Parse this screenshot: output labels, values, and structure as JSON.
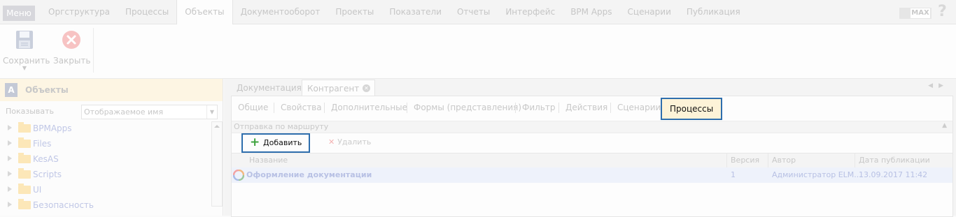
{
  "topbar": {
    "menu_label": "Меню",
    "nav_items": [
      "Оргструктура",
      "Процессы",
      "Объекты",
      "Документооборот",
      "Проекты",
      "Показатели",
      "Отчеты",
      "Интерфейс",
      "BPM Apps",
      "Сценарии",
      "Публикация"
    ],
    "active_nav": "Объекты",
    "max_badge": "MAX",
    "help": "?"
  },
  "toolbar": {
    "save_label": "Сохранить",
    "close_label": "Закрыть",
    "save_icon": "floppy-disk-icon",
    "close_icon": "close-circle-icon"
  },
  "left_panel": {
    "logo_letter": "A",
    "title": "Объекты",
    "show_label": "Показывать",
    "display_select_value": "Отображаемое имя",
    "tree_items": [
      "BPMApps",
      "Files",
      "KesAS",
      "Scripts",
      "UI",
      "Безопасность"
    ]
  },
  "right_panel": {
    "doc_tabs": [
      "Документация",
      "Контрагент"
    ],
    "active_doc_tab": "Контрагент",
    "sub_tabs": [
      "Общие",
      "Свойства",
      "Дополнительные",
      "Формы (представления)",
      "Фильтр",
      "Действия",
      "Сценарии",
      "Процессы"
    ],
    "active_sub_tab": "Процессы",
    "route_title": "Отправка по маршруту",
    "add_label": "Добавить",
    "delete_label": "Удалить",
    "columns": [
      "Название",
      "Версия",
      "Автор",
      "Дата публикации"
    ],
    "rows": [
      {
        "name": "Оформление документации",
        "version": "1",
        "author": "Администратор ELM...",
        "date": "13.09.2017 11:42"
      }
    ]
  },
  "colors": {
    "highlight_border": "#2e6ead",
    "active_tab_bg": "#fdf3d8",
    "add_icon": "#3ea33e",
    "delete_icon": "#f4b1b1",
    "link_text": "#b8c1e4"
  }
}
